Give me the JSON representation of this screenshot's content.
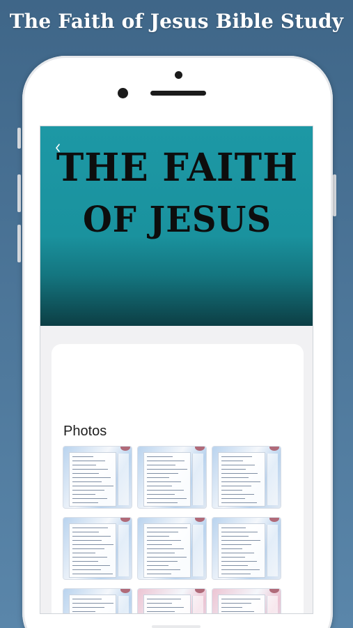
{
  "promo": {
    "title": "The Faith of Jesus Bible Study"
  },
  "hero": {
    "line1": "THE FAITH",
    "line2": "OF JESUS"
  },
  "icons": {
    "back": "chevron-left-icon"
  },
  "photos": {
    "title": "Photos",
    "thumbnails": [
      {
        "style": "blue"
      },
      {
        "style": "blue"
      },
      {
        "style": "blue"
      },
      {
        "style": "blue"
      },
      {
        "style": "blue"
      },
      {
        "style": "blue"
      },
      {
        "style": "blue"
      },
      {
        "style": "pink"
      },
      {
        "style": "pink"
      }
    ]
  },
  "colors": {
    "background": "#4a7396",
    "hero_teal": "#1d98a5",
    "hero_dark": "#0c3e44",
    "thumb_blue": "#b9d3ee",
    "thumb_pink": "#ecc4d3"
  }
}
